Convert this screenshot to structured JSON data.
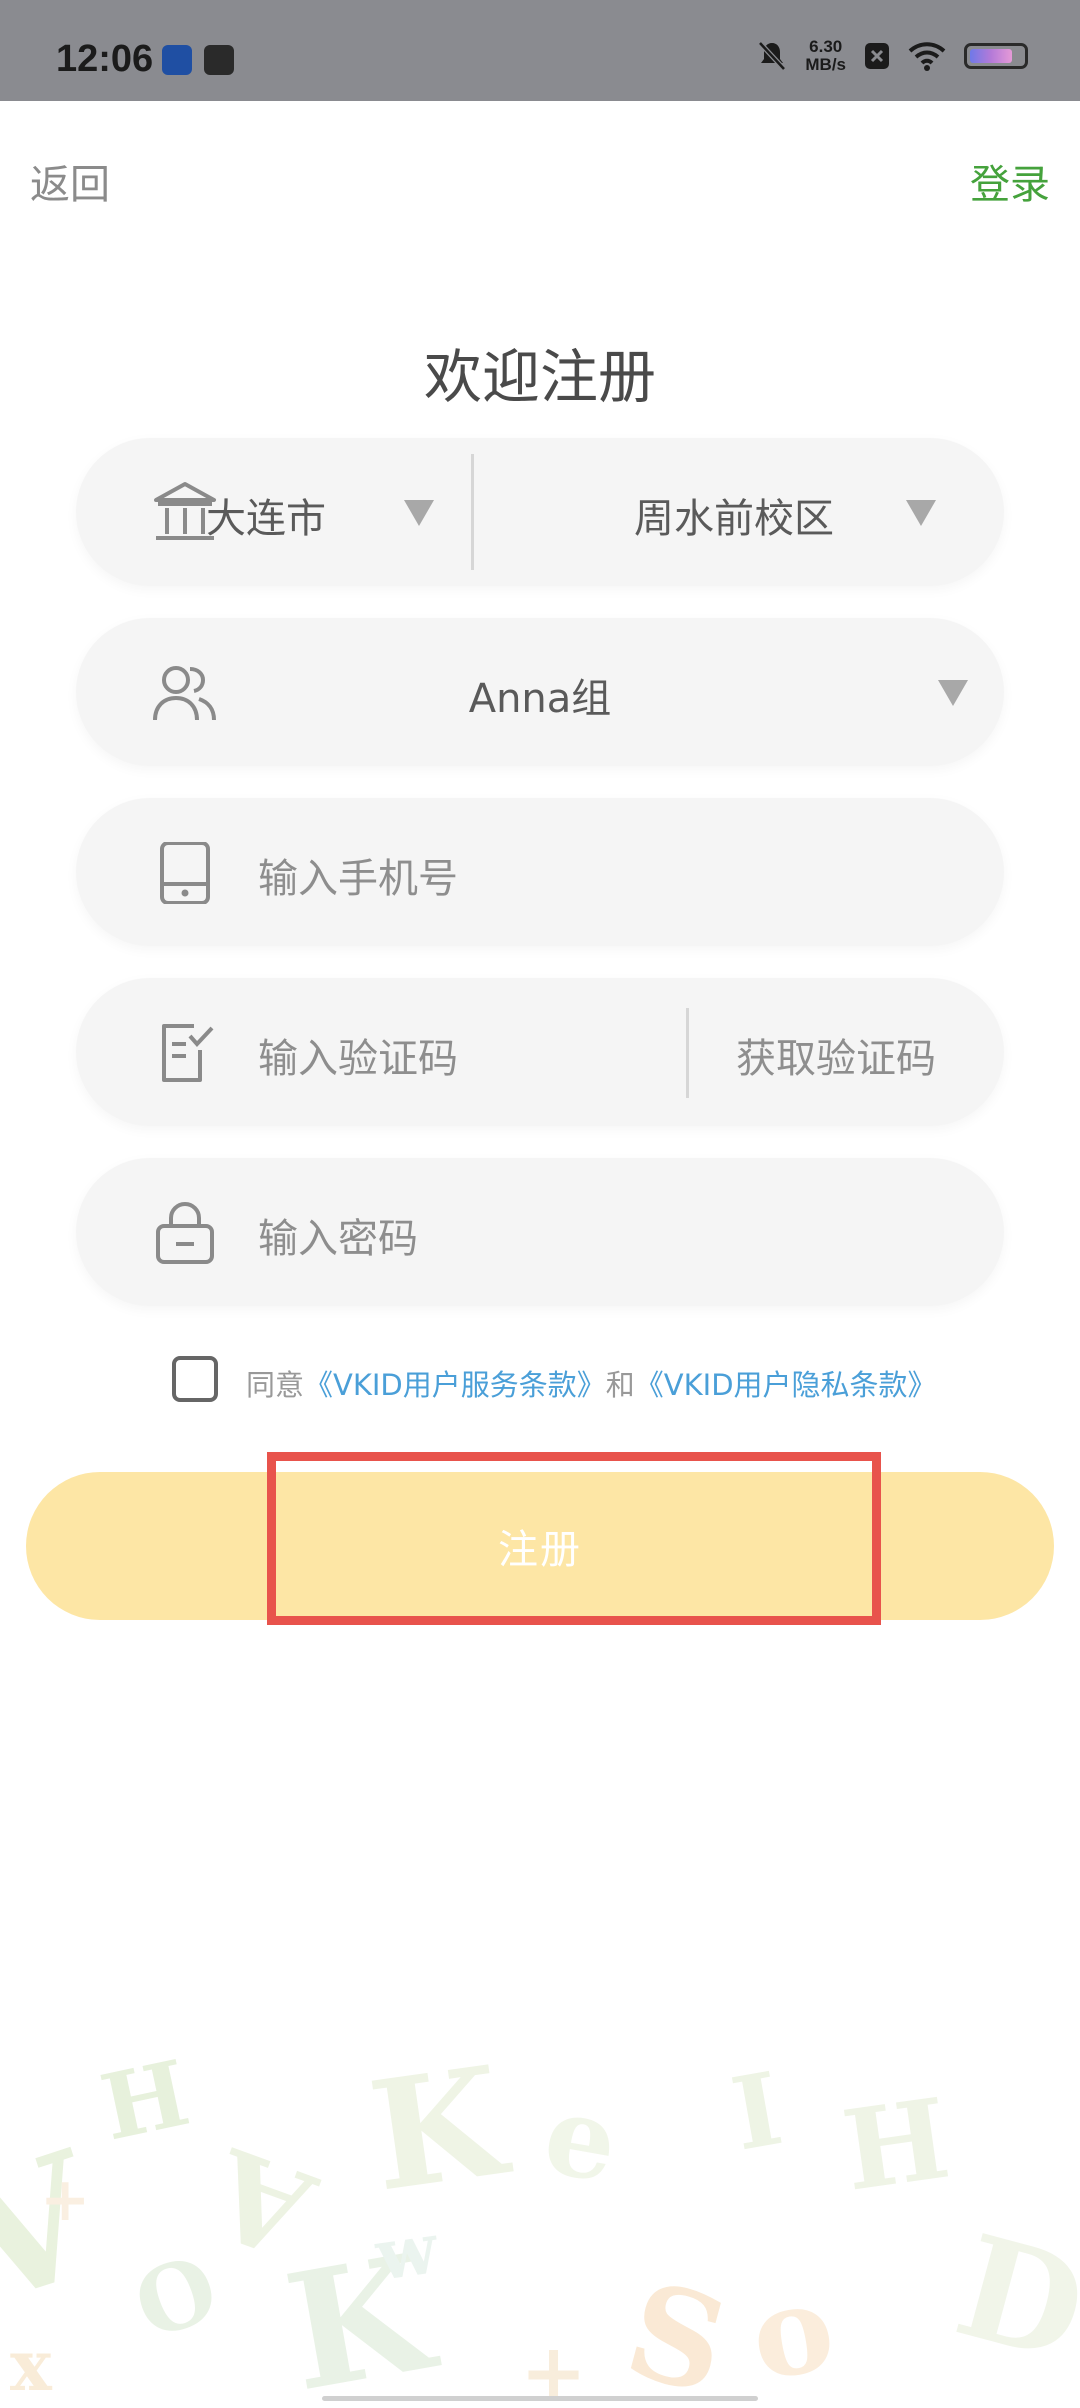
{
  "status_bar": {
    "time": "12:06",
    "speed_value": "6.30",
    "speed_unit": "MB/s",
    "battery_level": 0.8
  },
  "topbar": {
    "back_label": "返回",
    "login_label": "登录"
  },
  "title": "欢迎注册",
  "form": {
    "city": {
      "value": "大连市",
      "icon": "building-icon"
    },
    "campus": {
      "value": "周水前校区"
    },
    "group": {
      "value": "Anna组",
      "icon": "users-icon"
    },
    "phone": {
      "placeholder": "输入手机号",
      "icon": "phone-icon"
    },
    "code": {
      "placeholder": "输入验证码",
      "icon": "document-check-icon",
      "get_code_label": "获取验证码"
    },
    "password": {
      "placeholder": "输入密码",
      "icon": "lock-icon"
    }
  },
  "agreement": {
    "prefix": "同意",
    "service_link": "《VKID用户服务条款》",
    "connector": "和",
    "privacy_link": "《VKID用户隐私条款》"
  },
  "register_button": {
    "label": "注册"
  },
  "colors": {
    "accent_green": "#45a23c",
    "button_yellow": "#fde6a5",
    "link_blue": "#4a9fd8",
    "highlight_red": "#e8534c"
  }
}
